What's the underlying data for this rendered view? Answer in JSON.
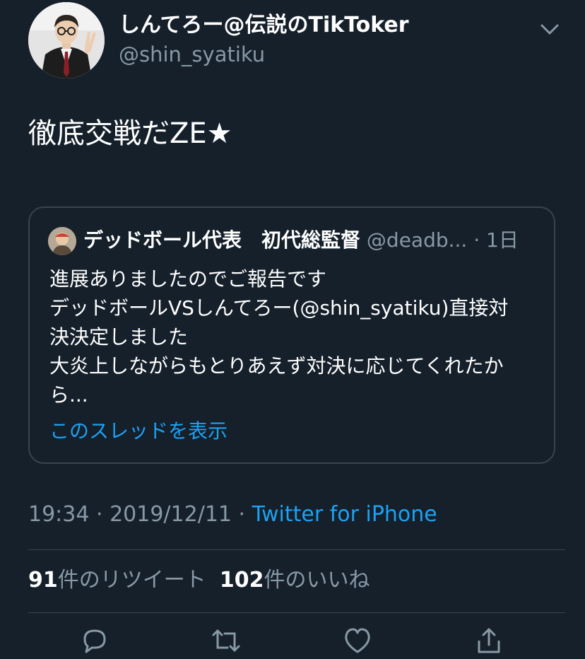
{
  "author": {
    "display_name": "しんてろー@伝説のTikToker",
    "handle": "@shin_syatiku"
  },
  "tweet": {
    "text": "徹底交戦だZE★"
  },
  "quoted_tweet": {
    "display_name": "デッドボール代表　初代総監督",
    "handle": "@deadb...",
    "separator": "·",
    "time": "1日",
    "lines": [
      "進展ありましたのでご報告です",
      "デッドボールVSしんてろー(@shin_syatiku)直接対",
      "決決定しました",
      "大炎上しながらもとりあえず対決に応じてくれたか",
      "ら..."
    ],
    "show_thread": "このスレッドを表示"
  },
  "meta": {
    "time": "19:34",
    "separator1": " · ",
    "date": "2019/12/11",
    "separator2": " · ",
    "source": "Twitter for iPhone"
  },
  "stats": {
    "retweets_count": "91",
    "retweets_label": "件のリツイート",
    "likes_count": "102",
    "likes_label": "件のいいね"
  },
  "icons": {
    "menu": "chevron-down-icon",
    "reply": "reply-icon",
    "retweet": "retweet-icon",
    "like": "heart-icon",
    "share": "share-icon"
  },
  "colors": {
    "background": "#15202b",
    "accent": "#1da1f2",
    "secondary_text": "#8899a6",
    "border": "#38444d"
  }
}
